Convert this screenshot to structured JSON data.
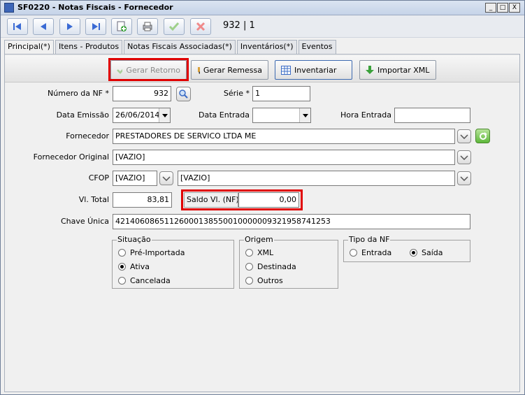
{
  "window": {
    "title": "SF0220 - Notas Fiscais - Fornecedor",
    "buttons": [
      "_",
      "□",
      "X"
    ]
  },
  "toolbar": {
    "record": "932 | 1"
  },
  "tabs": [
    "Principal(*)",
    "Itens - Produtos",
    "Notas Fiscais Associadas(*)",
    "Inventários(*)",
    "Eventos"
  ],
  "actions": {
    "gerar_retorno": "Gerar Retorno",
    "gerar_remessa": "Gerar Remessa",
    "inventariar": "Inventariar",
    "importar_xml": "Importar XML"
  },
  "form": {
    "numero_nf_label": "Número da NF *",
    "numero_nf": "932",
    "serie_label": "Série *",
    "serie": "1",
    "data_emissao_label": "Data Emissão",
    "data_emissao": "26/06/2014",
    "data_entrada_label": "Data Entrada",
    "data_entrada": "",
    "hora_entrada_label": "Hora Entrada",
    "hora_entrada": "",
    "fornecedor_label": "Fornecedor",
    "fornecedor": "PRESTADORES DE SERVICO LTDA ME",
    "fornecedor_original_label": "Fornecedor Original",
    "fornecedor_original": "[VAZIO]",
    "cfop_label": "CFOP",
    "cfop_code": "[VAZIO]",
    "cfop_desc": "[VAZIO]",
    "vl_total_label": "Vl. Total",
    "vl_total": "83,81",
    "saldo_label": "Saldo Vl. (NF)",
    "saldo": "0,00",
    "chave_label": "Chave Única",
    "chave": "42140608651126000138550010000009321958741253"
  },
  "situacao": {
    "title": "Situação",
    "options": [
      "Pré-Importada",
      "Ativa",
      "Cancelada"
    ],
    "selected": "Ativa"
  },
  "origem": {
    "title": "Origem",
    "options": [
      "XML",
      "Destinada",
      "Outros"
    ],
    "selected": ""
  },
  "tipo_nf": {
    "title": "Tipo da NF",
    "options": [
      "Entrada",
      "Saída"
    ],
    "selected": "Saída"
  },
  "colors": {
    "highlight": "#e00000",
    "accent": "#3d66b8"
  }
}
